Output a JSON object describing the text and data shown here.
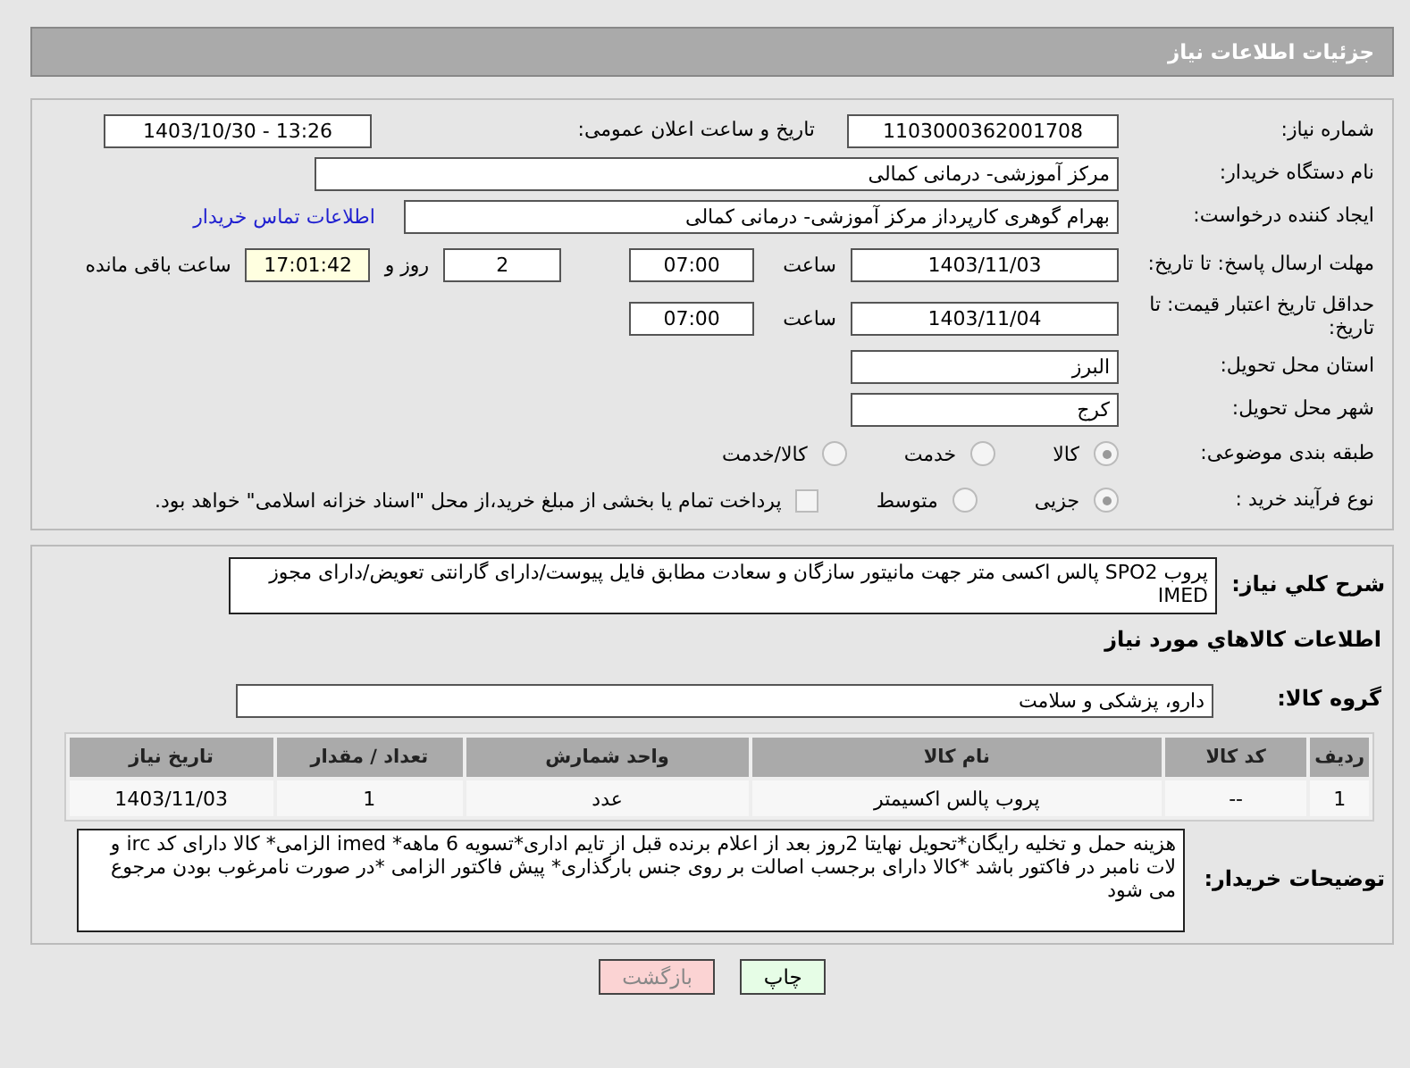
{
  "header": {
    "title": "جزئیات اطلاعات نیاز"
  },
  "need_number": {
    "label": "شماره نیاز:",
    "value": "1103000362001708"
  },
  "announce": {
    "label": "تاریخ و ساعت اعلان عمومی:",
    "value": "1403/10/30 - 13:26"
  },
  "buyer_org": {
    "label": "نام دستگاه خریدار:",
    "value": "مرکز آموزشی- درمانی کمالی"
  },
  "requester": {
    "label": "ایجاد کننده درخواست:",
    "value": "بهرام گوهری کارپرداز مرکز آموزشی- درمانی کمالی",
    "link": "اطلاعات تماس خریدار"
  },
  "reply_deadline": {
    "label": "مهلت ارسال پاسخ: تا تاریخ:",
    "date": "1403/11/03",
    "time_label": "ساعت",
    "time": "07:00",
    "days": "2",
    "days_label": "روز و",
    "remaining": "17:01:42",
    "remaining_label": "ساعت باقی مانده"
  },
  "price_validity": {
    "label": "حداقل تاریخ اعتبار قیمت: تا تاریخ:",
    "date": "1403/11/04",
    "time_label": "ساعت",
    "time": "07:00"
  },
  "province": {
    "label": "استان محل تحویل:",
    "value": "البرز"
  },
  "city": {
    "label": "شهر محل تحویل:",
    "value": "کرج"
  },
  "category": {
    "label": "طبقه بندی موضوعی:",
    "options": [
      {
        "label": "کالا",
        "selected": true
      },
      {
        "label": "خدمت",
        "selected": false
      },
      {
        "label": "کالا/خدمت",
        "selected": false
      }
    ]
  },
  "purchase_process": {
    "label": "نوع فرآیند خرید :",
    "options": [
      {
        "label": "جزیی",
        "selected": true
      },
      {
        "label": "متوسط",
        "selected": false
      }
    ],
    "treasury": {
      "label": "پرداخت تمام یا بخشی از مبلغ خرید،از محل \"اسناد خزانه اسلامی\" خواهد بود.",
      "checked": false
    }
  },
  "description": {
    "label": "شرح كلي نياز:",
    "value": "پروب SPO2 پالس اکسی متر جهت مانیتور سازگان و سعادت مطابق فایل پیوست/دارای گارانتی تعویض/دارای مجوز IMED"
  },
  "goods_heading": "اطلاعات كالاهاي مورد نياز",
  "goods_group": {
    "label": "گروه کالا:",
    "value": "دارو، پزشکی و سلامت"
  },
  "table": {
    "columns": [
      "ردیف",
      "کد کالا",
      "نام کالا",
      "واحد شمارش",
      "تعداد / مقدار",
      "تاریخ نیاز"
    ],
    "rows": [
      [
        "1",
        "--",
        "پروب پالس اکسیمتر",
        "عدد",
        "1",
        "1403/11/03"
      ]
    ]
  },
  "buyer_notes": {
    "label": "توضیحات خریدار:",
    "value": "هزینه حمل و تخلیه رایگان*تحویل نهایتا 2روز بعد از اعلام برنده قبل از تایم اداری*تسویه 6 ماهه* imed الزامی* کالا دارای کد irc و لات نامبر در فاکتور باشد *کالا دارای برجسب اصالت بر روی جنس بارگذاری* پیش فاکتور الزامی *در صورت نامرغوب بودن مرجوع می شود"
  },
  "buttons": [
    {
      "label": "چاپ",
      "kind": "print"
    },
    {
      "label": "بازگشت",
      "kind": "back"
    }
  ]
}
